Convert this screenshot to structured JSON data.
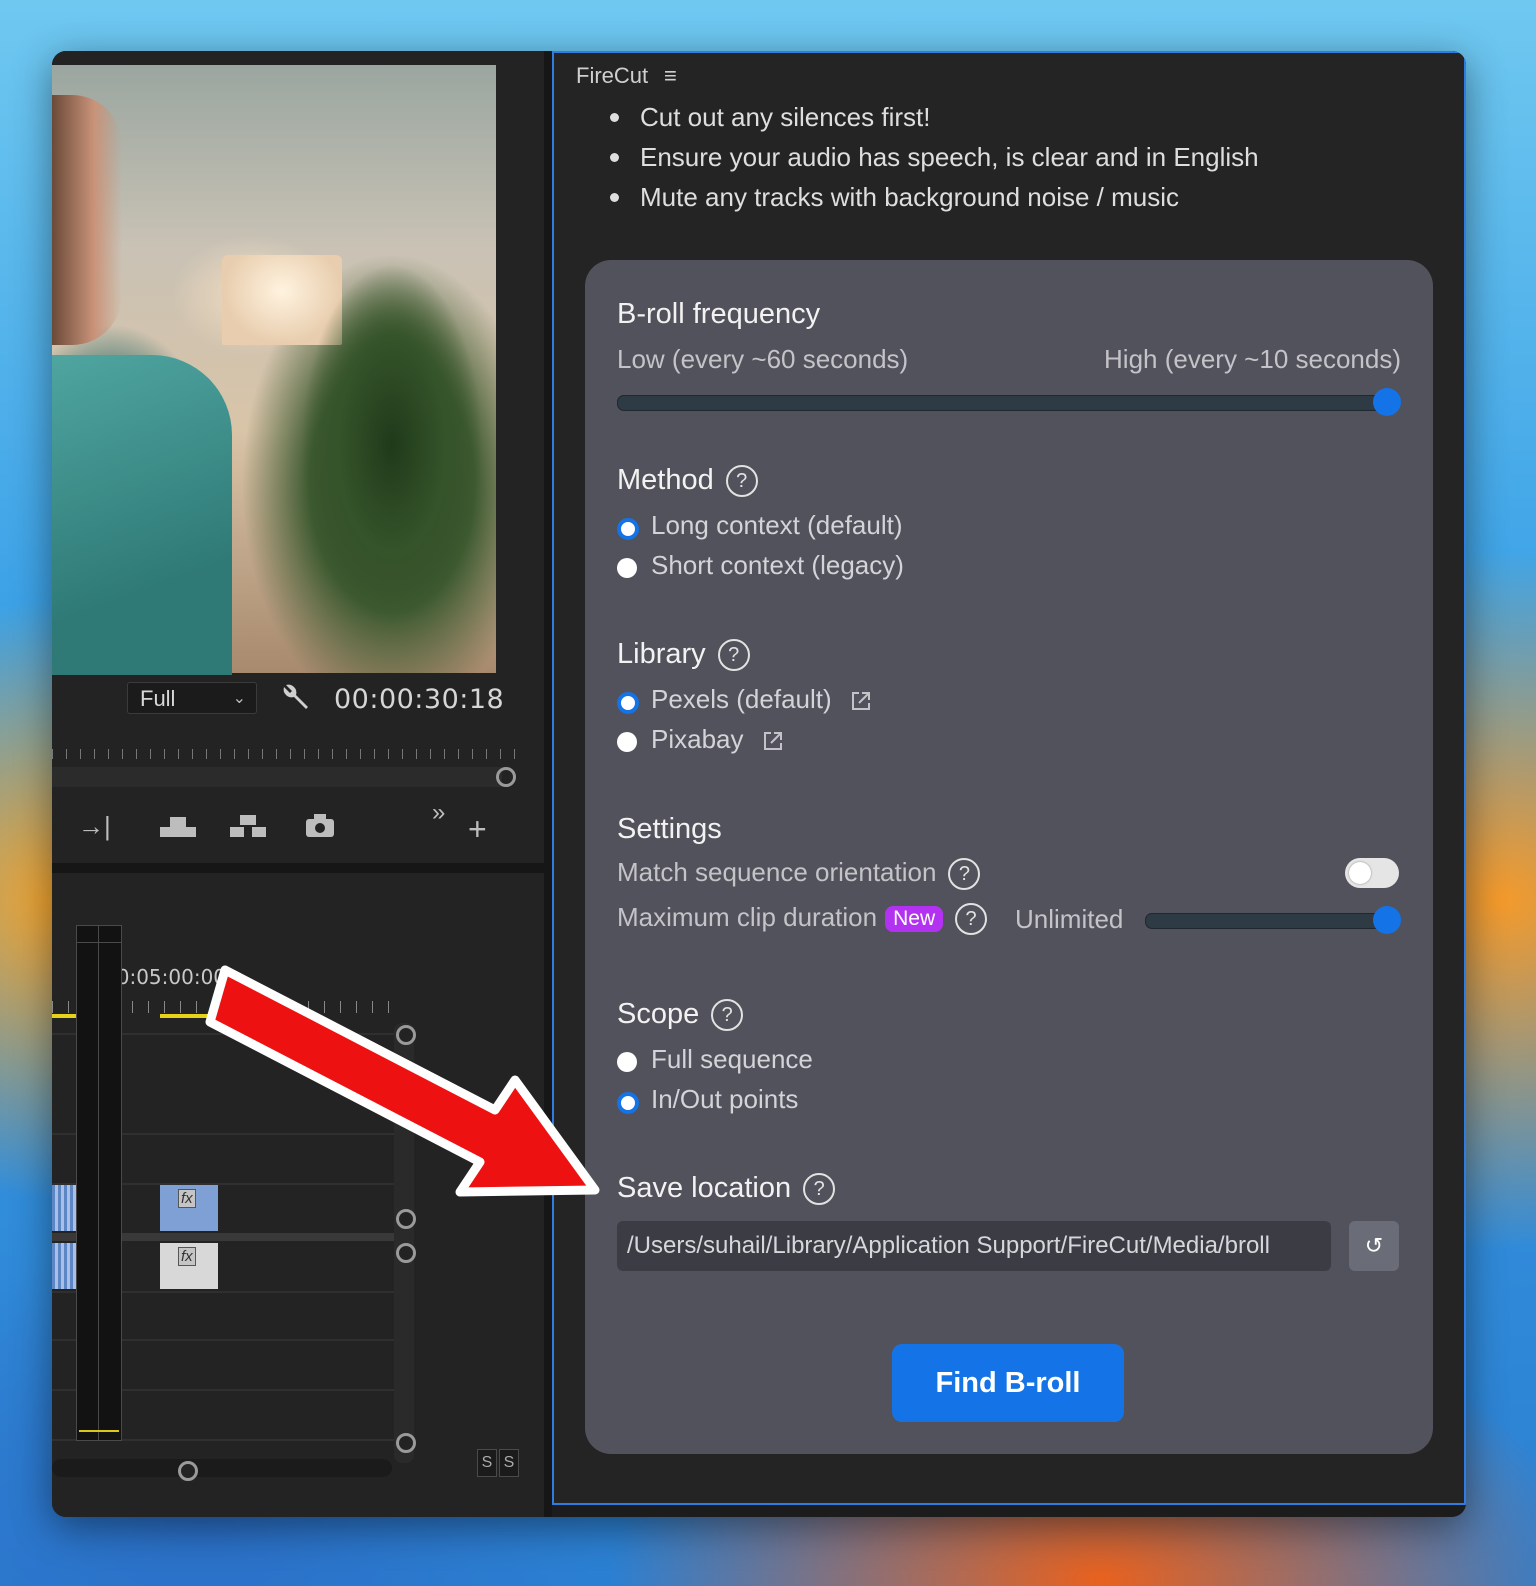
{
  "premiere": {
    "quality_value": "Full",
    "timecode": "00:00:30:18",
    "timeline_time": "00:05:00:00",
    "solo_labels": [
      "S",
      "S"
    ],
    "fx_label": "fx"
  },
  "firecut": {
    "title": "FireCut",
    "tips": [
      "Cut out any silences first!",
      "Ensure your audio has speech, is clear and in English",
      "Mute any tracks with background noise / music"
    ],
    "broll_frequency": {
      "title": "B-roll frequency",
      "low_label": "Low (every ~60 seconds)",
      "high_label": "High (every ~10 seconds)",
      "value_fraction": 1.0
    },
    "method": {
      "title": "Method",
      "options": [
        "Long context (default)",
        "Short context (legacy)"
      ],
      "selected": "Long context (default)"
    },
    "library": {
      "title": "Library",
      "options": [
        "Pexels (default)",
        "Pixabay"
      ],
      "selected": "Pexels (default)"
    },
    "settings": {
      "title": "Settings",
      "match_orientation_label": "Match sequence orientation",
      "match_orientation_on": false,
      "max_clip_label": "Maximum clip duration",
      "new_badge": "New",
      "max_clip_value": "Unlimited",
      "max_clip_fraction": 1.0
    },
    "scope": {
      "title": "Scope",
      "options": [
        "Full sequence",
        "In/Out points"
      ],
      "selected": "In/Out points"
    },
    "save_location": {
      "title": "Save location",
      "path": "/Users/suhail/Library/Application Support/FireCut/Media/broll",
      "reset_icon": "↺"
    },
    "find_button": "Find B-roll",
    "help_glyph": "?"
  },
  "colors": {
    "accent": "#1473e6",
    "new_badge": "#b331f0",
    "arrow": "#ee1111"
  }
}
